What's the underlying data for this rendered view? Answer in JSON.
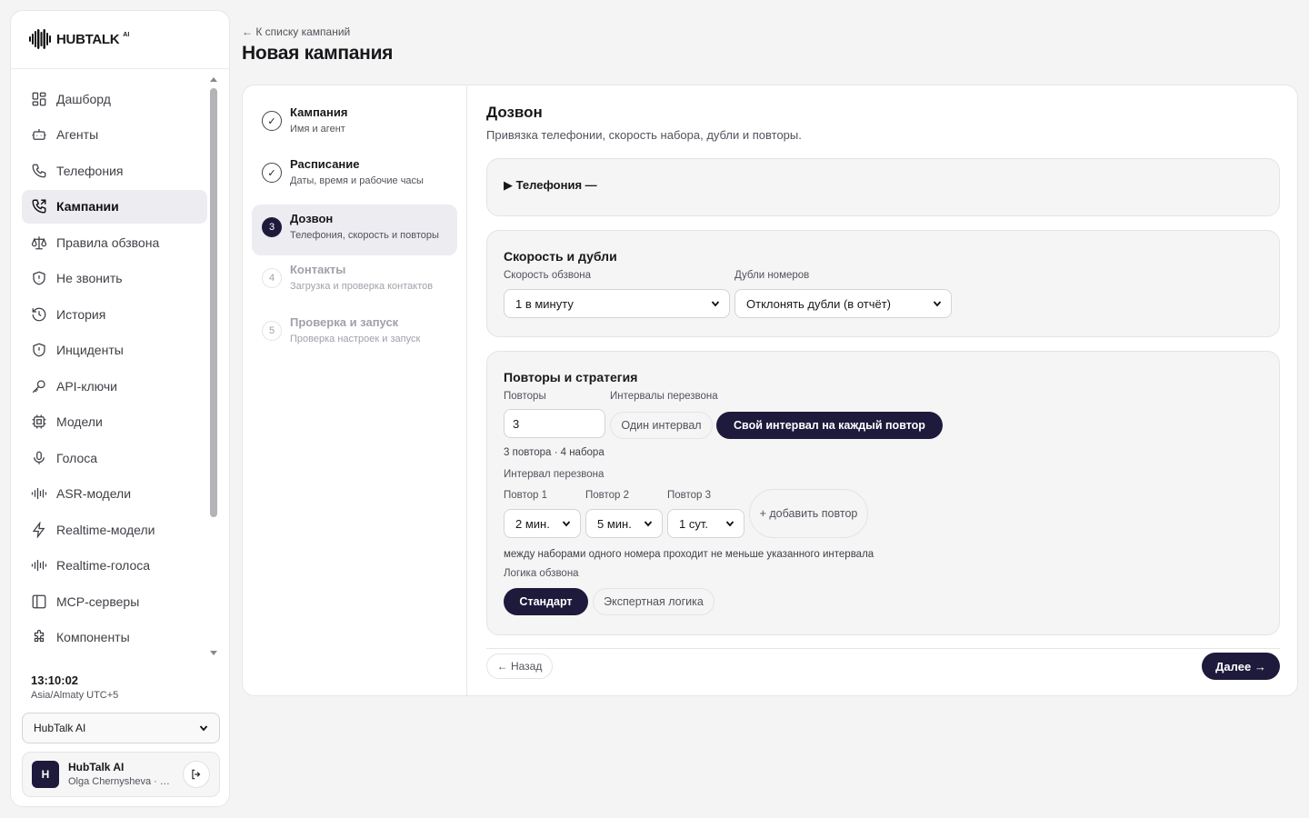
{
  "brand": {
    "name": "HUBTALK",
    "suffix": "AI"
  },
  "sidebar": {
    "items": [
      {
        "label": "Дашборд",
        "icon": "dashboard-icon"
      },
      {
        "label": "Агенты",
        "icon": "bot-icon"
      },
      {
        "label": "Телефония",
        "icon": "phone-icon"
      },
      {
        "label": "Кампании",
        "icon": "phone-outgoing-icon",
        "active": true
      },
      {
        "label": "Правила обзвона",
        "icon": "scale-icon"
      },
      {
        "label": "Не звонить",
        "icon": "shield-icon"
      },
      {
        "label": "История",
        "icon": "history-icon"
      },
      {
        "label": "Инциденты",
        "icon": "shield-alert-icon"
      },
      {
        "label": "API-ключи",
        "icon": "key-icon"
      },
      {
        "label": "Модели",
        "icon": "cpu-icon"
      },
      {
        "label": "Голоса",
        "icon": "mic-icon"
      },
      {
        "label": "ASR-модели",
        "icon": "waveform-icon"
      },
      {
        "label": "Realtime-модели",
        "icon": "zap-icon"
      },
      {
        "label": "Realtime-голоса",
        "icon": "waveform-icon"
      },
      {
        "label": "MCP-серверы",
        "icon": "panel-icon"
      },
      {
        "label": "Компоненты",
        "icon": "puzzle-icon"
      }
    ],
    "clock": "13:10:02",
    "timezone": "Asia/Almaty UTC+5",
    "org_selected": "HubTalk AI",
    "user": {
      "initial": "H",
      "name": "HubTalk AI",
      "sub": "Olga Chernysheva · HubTalk"
    }
  },
  "header": {
    "back_link": "← К списку кампаний",
    "title": "Новая кампания"
  },
  "steps": [
    {
      "num": "✓",
      "title": "Кампания",
      "sub": "Имя и агент",
      "state": "done"
    },
    {
      "num": "✓",
      "title": "Расписание",
      "sub": "Даты, время и рабочие часы",
      "state": "done"
    },
    {
      "num": "3",
      "title": "Дозвон",
      "sub": "Телефония, скорость и повторы",
      "state": "current"
    },
    {
      "num": "4",
      "title": "Контакты",
      "sub": "Загрузка и проверка контактов",
      "state": "todo"
    },
    {
      "num": "5",
      "title": "Проверка и запуск",
      "sub": "Проверка настроек и запуск",
      "state": "todo"
    }
  ],
  "section": {
    "title": "Дозвон",
    "subtitle": "Привязка телефонии, скорость набора, дубли и повторы."
  },
  "telephony": {
    "summary": "▶ Телефония —"
  },
  "speed": {
    "title": "Скорость и дубли",
    "speed_label": "Скорость обзвона",
    "speed_value": "1 в минуту",
    "dupes_label": "Дубли номеров",
    "dupes_value": "Отклонять дубли (в отчёт)"
  },
  "retries": {
    "title": "Повторы и стратегия",
    "retries_label": "Повторы",
    "retries_value": "3",
    "intervals_label": "Интервалы перезвона",
    "single_interval": "Один интервал",
    "custom_interval": "Свой интервал на каждый повтор",
    "summary": "3 повтора · 4 набора",
    "interval_label": "Интервал перезвона",
    "retry_items": [
      {
        "label": "Повтор 1",
        "value": "2 мин."
      },
      {
        "label": "Повтор 2",
        "value": "5 мин."
      },
      {
        "label": "Повтор 3",
        "value": "1 сут."
      }
    ],
    "add_retry": "+ добавить повтор",
    "note": "между наборами одного номера проходит не меньше указанного интервала",
    "logic_label": "Логика обзвона",
    "logic_standard": "Стандарт",
    "logic_expert": "Экспертная логика"
  },
  "footer": {
    "back": "← Назад",
    "next": "Далее →"
  },
  "colors": {
    "accent": "#1e1a3c",
    "active_bg": "#ececf1"
  }
}
